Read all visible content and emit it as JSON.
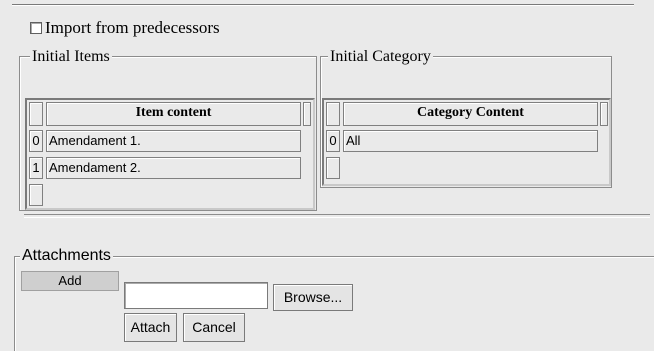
{
  "import_checkbox": {
    "label": "Import from predecessors",
    "checked": false
  },
  "items_panel": {
    "legend": "Initial Items",
    "header": "Item content",
    "rows": [
      {
        "index": "0",
        "text": "Amendament 1."
      },
      {
        "index": "1",
        "text": "Amendament 2."
      }
    ]
  },
  "category_panel": {
    "legend": "Initial Category",
    "header": "Category Content",
    "rows": [
      {
        "index": "0",
        "text": "All"
      }
    ]
  },
  "attachments": {
    "legend": "Attachments",
    "add_label": "Add",
    "file_value": "",
    "browse_label": "Browse...",
    "attach_label": "Attach",
    "cancel_label": "Cancel"
  }
}
